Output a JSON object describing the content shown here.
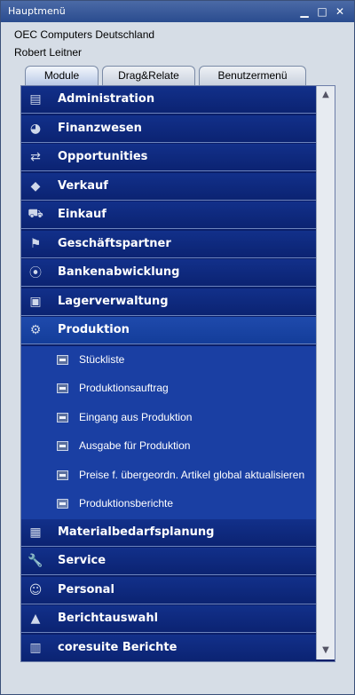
{
  "window": {
    "title": "Hauptmenü",
    "minimize": "▁",
    "maximize": "□",
    "close": "✕"
  },
  "header": {
    "company": "OEC Computers Deutschland",
    "user": "Robert Leitner"
  },
  "tabs": [
    {
      "label": "Module",
      "active": true
    },
    {
      "label": "Drag&Relate",
      "active": false
    },
    {
      "label": "Benutzermenü",
      "active": false
    }
  ],
  "modules": [
    {
      "label": "Administration",
      "icon": "document-icon",
      "glyph": "▤"
    },
    {
      "label": "Finanzwesen",
      "icon": "pie-chart-icon",
      "glyph": "◕"
    },
    {
      "label": "Opportunities",
      "icon": "arrows-icon",
      "glyph": "⇄"
    },
    {
      "label": "Verkauf",
      "icon": "tag-icon",
      "glyph": "◆"
    },
    {
      "label": "Einkauf",
      "icon": "cart-icon",
      "glyph": "⛟"
    },
    {
      "label": "Geschäftspartner",
      "icon": "partners-icon",
      "glyph": "⚑"
    },
    {
      "label": "Bankenabwicklung",
      "icon": "coins-icon",
      "glyph": "⦿"
    },
    {
      "label": "Lagerverwaltung",
      "icon": "box-icon",
      "glyph": "▣"
    },
    {
      "label": "Produktion",
      "icon": "gear-icon",
      "glyph": "⚙",
      "selected": true
    },
    {
      "label": "Materialbedarfsplanung",
      "icon": "chart-icon",
      "glyph": "▦"
    },
    {
      "label": "Service",
      "icon": "wrench-icon",
      "glyph": "🔧"
    },
    {
      "label": "Personal",
      "icon": "people-icon",
      "glyph": "☺"
    },
    {
      "label": "Berichtauswahl",
      "icon": "report-chart-icon",
      "glyph": "▲"
    },
    {
      "label": "coresuite Berichte",
      "icon": "report-icon",
      "glyph": "▥"
    }
  ],
  "production_subitems": [
    {
      "label": "Stückliste",
      "icon": "window-icon"
    },
    {
      "label": "Produktionsauftrag",
      "icon": "window-icon"
    },
    {
      "label": "Eingang aus Produktion",
      "icon": "window-icon"
    },
    {
      "label": "Ausgabe für Produktion",
      "icon": "window-icon"
    },
    {
      "label": "Preise f. übergeordn. Artikel global aktualisieren",
      "icon": "window-icon"
    },
    {
      "label": "Produktionsberichte",
      "icon": "folder-icon"
    }
  ],
  "scroll": {
    "up": "▲",
    "down": "▼"
  }
}
